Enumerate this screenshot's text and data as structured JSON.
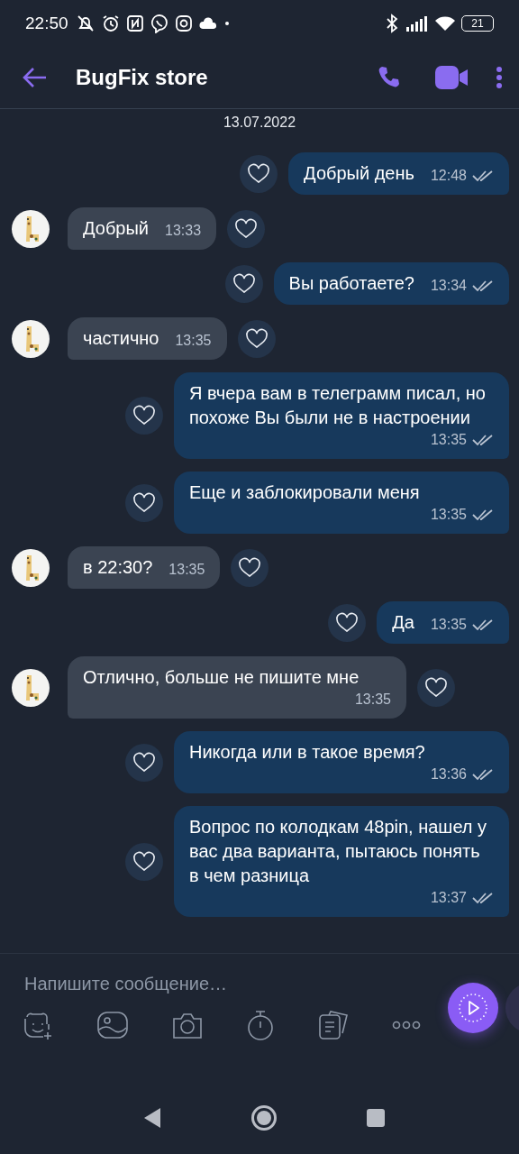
{
  "status_bar": {
    "time": "22:50",
    "battery": "21"
  },
  "header": {
    "title": "BugFix store"
  },
  "date": "13.07.2022",
  "messages": [
    {
      "kind": "out",
      "text": "Добрый день",
      "time": "12:48"
    },
    {
      "kind": "in",
      "text": "Добрый",
      "time": "13:33"
    },
    {
      "kind": "out",
      "text": "Вы работаете?",
      "time": "13:34"
    },
    {
      "kind": "in",
      "text": "частично",
      "time": "13:35"
    },
    {
      "kind": "out",
      "text": "Я вчера вам в телеграмм писал, но похоже Вы были не в настроении",
      "time": "13:35"
    },
    {
      "kind": "out",
      "text": "Еще и заблокировали меня",
      "time": "13:35"
    },
    {
      "kind": "in",
      "text": "в 22:30?",
      "time": "13:35"
    },
    {
      "kind": "out",
      "text": "Да",
      "time": "13:35"
    },
    {
      "kind": "in",
      "text": "Отлично, больше не пишите мне",
      "time": "13:35"
    },
    {
      "kind": "out",
      "text": "Никогда или в такое время?",
      "time": "13:36"
    },
    {
      "kind": "out",
      "text": "Вопрос по колодкам 48pin, нашел у вас два варианта, пытаюсь понять в чем разница",
      "time": "13:37"
    }
  ],
  "composer": {
    "placeholder": "Напишите сообщение…"
  }
}
